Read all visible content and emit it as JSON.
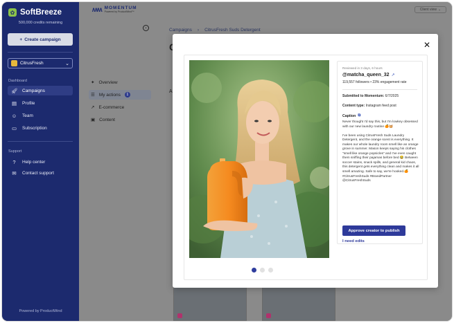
{
  "sidebar": {
    "brand": "SoftBreeze",
    "credits": "500,000 credits remaining",
    "create_label": "Create campaign",
    "org_name": "CitrusFresh",
    "dashboard_label": "Dashboard",
    "items": [
      {
        "label": "Campaigns",
        "icon": "rocket-icon"
      },
      {
        "label": "Profile",
        "icon": "document-icon"
      },
      {
        "label": "Team",
        "icon": "team-icon"
      },
      {
        "label": "Subscription",
        "icon": "credit-card-icon"
      }
    ],
    "support_label": "Support",
    "support_items": [
      {
        "label": "Help center",
        "icon": "help-icon"
      },
      {
        "label": "Contact support",
        "icon": "chat-icon"
      }
    ],
    "powered_by": "Powered by ProductWind"
  },
  "topbar": {
    "logo_title": "MOMENTUM",
    "logo_sub": "Powered by ProductWind™",
    "client_view": "Client view"
  },
  "main": {
    "breadcrumb": [
      "Campaigns",
      "CitrusFresh Suds Detergent"
    ],
    "page_initial": "C",
    "heading_initial": "A",
    "subnav": [
      {
        "label": "Overview",
        "icon": "sparkle-icon"
      },
      {
        "label": "My actions",
        "icon": "checklist-icon",
        "count": "1"
      },
      {
        "label": "E-commerce",
        "icon": "trend-icon"
      },
      {
        "label": "Content",
        "icon": "image-icon"
      }
    ]
  },
  "modal": {
    "reviewed": "Reviewed in 3 days, 6 hours",
    "handle": "@matcha_queen_32",
    "stats": "119,557 followers  •  23% engagement rate",
    "submitted_label": "Submitted to Momentum:",
    "submitted_date": "6/7/2025",
    "content_type_label": "Content type:",
    "content_type": "Instagram feed post",
    "caption_label": "Caption",
    "caption": "Never thought I'd say this, but I'm lowkey obsessed with our new laundry routine 🍊🧺\n\nI've been using CitrusFresh Suds Laundry Detergent, and the orange scent is everything. It makes our whole laundry room smell like an orange grove in summer. Mason keeps saying his clothes \"smell like orange popsicles\" and I've even caught them sniffing their pajamas before bed 😂 Between soccer stains, snack spills, and general kid chaos, this detergent gets everything clean and makes it all smell amazing. Safe to say, we're hooked.🍊\n#CitrusFreshSuds #BrandPartner\n@CitrusFreshSuds",
    "approve_label": "Approve creator to publish",
    "edits_label": "I need edits",
    "close_icon": "close-icon",
    "carousel": {
      "count": 3,
      "active": 1
    }
  },
  "colors": {
    "sidebar_bg": "#1c2a6e",
    "accent": "#2e3a9a",
    "bottle": "#f58a1f"
  }
}
